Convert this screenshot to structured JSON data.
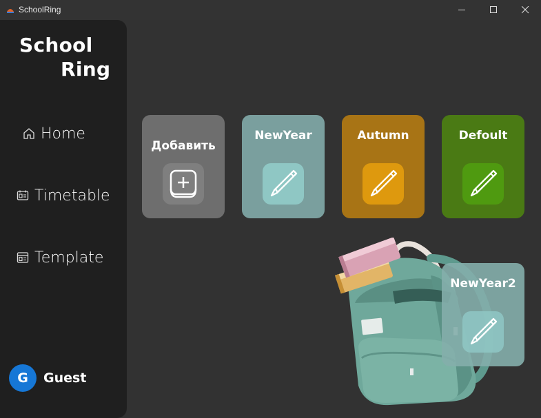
{
  "window": {
    "title": "SchoolRing",
    "icons": [
      "app-logo-icon",
      "minimize-icon",
      "maximize-icon",
      "close-icon"
    ]
  },
  "sidebar": {
    "logo_line1": "School",
    "logo_line2": "Ring",
    "nav": [
      {
        "label": "Home",
        "icon": "home-icon"
      },
      {
        "label": "Timetable",
        "icon": "calendar-icon"
      },
      {
        "label": "Template",
        "icon": "template-icon"
      }
    ],
    "user": {
      "initial": "G",
      "name": "Guest",
      "avatar_color": "#1677d6"
    }
  },
  "main": {
    "add_card": {
      "label": "Добавить",
      "icon": "plus-icon",
      "color": "#6e6e6e"
    },
    "templates": [
      {
        "label": "NewYear",
        "color": "#7a9f9e",
        "icon_color": "#8fc7c4",
        "icon": "pencil-icon"
      },
      {
        "label": "Autumn",
        "color": "#a87415",
        "icon_color": "#de990e",
        "icon": "pencil-icon"
      },
      {
        "label": "Defoult",
        "color": "#4a7a14",
        "icon_color": "#4f9a10",
        "icon": "pencil-icon"
      },
      {
        "label": "NewYear2",
        "color": "#84aeab",
        "icon_color": "#8fc7c4",
        "icon": "pencil-icon"
      }
    ],
    "illustration": "backpack-illustration"
  }
}
